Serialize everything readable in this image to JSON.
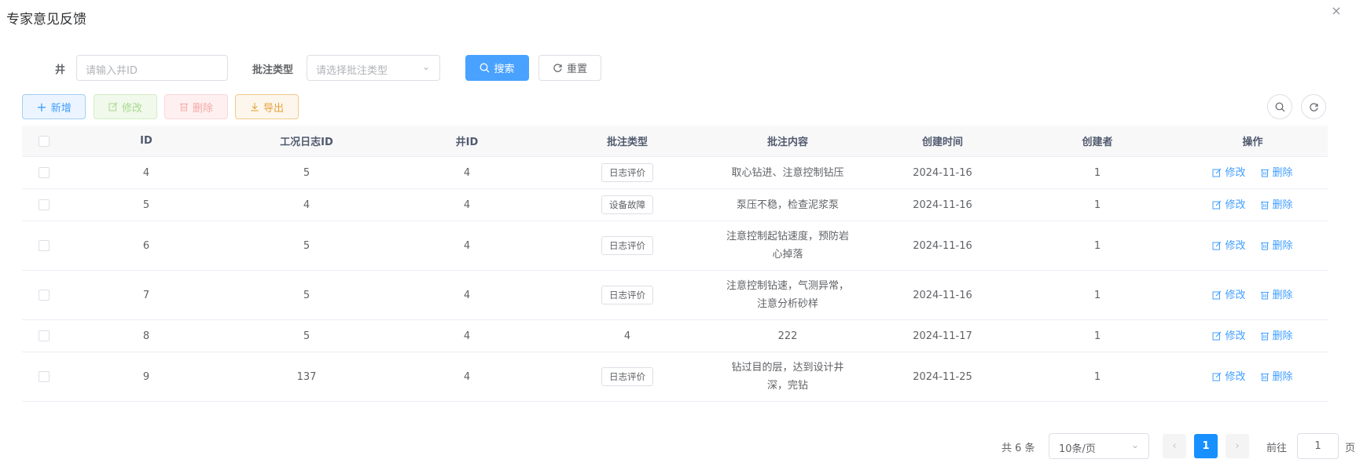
{
  "dialog": {
    "title": "专家意见反馈",
    "close": "×"
  },
  "search": {
    "well_label": "井",
    "well_placeholder": "请输入井ID",
    "type_label": "批注类型",
    "type_placeholder": "请选择批注类型",
    "search_label": "搜索",
    "reset_label": "重置"
  },
  "toolbar": {
    "add": "新增",
    "edit": "修改",
    "delete": "删除",
    "export": "导出"
  },
  "table": {
    "headers": [
      "ID",
      "工况日志ID",
      "井ID",
      "批注类型",
      "批注内容",
      "创建时间",
      "创建者",
      "操作"
    ],
    "rows": [
      {
        "id": "4",
        "log_id": "5",
        "well_id": "4",
        "type": "日志评价",
        "content": "取心钻进、注意控制钻压",
        "created": "2024-11-16",
        "creator": "1"
      },
      {
        "id": "5",
        "log_id": "4",
        "well_id": "4",
        "type": "设备故障",
        "content": "泵压不稳，检查泥浆泵",
        "created": "2024-11-16",
        "creator": "1"
      },
      {
        "id": "6",
        "log_id": "5",
        "well_id": "4",
        "type": "日志评价",
        "content": "注意控制起钻速度，预防岩心掉落",
        "created": "2024-11-16",
        "creator": "1"
      },
      {
        "id": "7",
        "log_id": "5",
        "well_id": "4",
        "type": "日志评价",
        "content": "注意控制钻速，气测异常，注意分析砂样",
        "created": "2024-11-16",
        "creator": "1"
      },
      {
        "id": "8",
        "log_id": "5",
        "well_id": "4",
        "type": "4",
        "content": "222",
        "created": "2024-11-17",
        "creator": "1"
      },
      {
        "id": "9",
        "log_id": "137",
        "well_id": "4",
        "type": "日志评价",
        "content": "钻过目的层，达到设计井深，完钻",
        "created": "2024-11-25",
        "creator": "1"
      }
    ],
    "row_edit": "修改",
    "row_delete": "删除"
  },
  "pagination": {
    "total": "共 6 条",
    "page_size": "10条/页",
    "current_page": "1",
    "goto_label": "前往",
    "goto_value": "1",
    "page_unit": "页"
  },
  "colors": {
    "primary": "#409eff",
    "success": "#67c23a",
    "danger": "#f56c6c",
    "warning": "#e6a23c"
  }
}
